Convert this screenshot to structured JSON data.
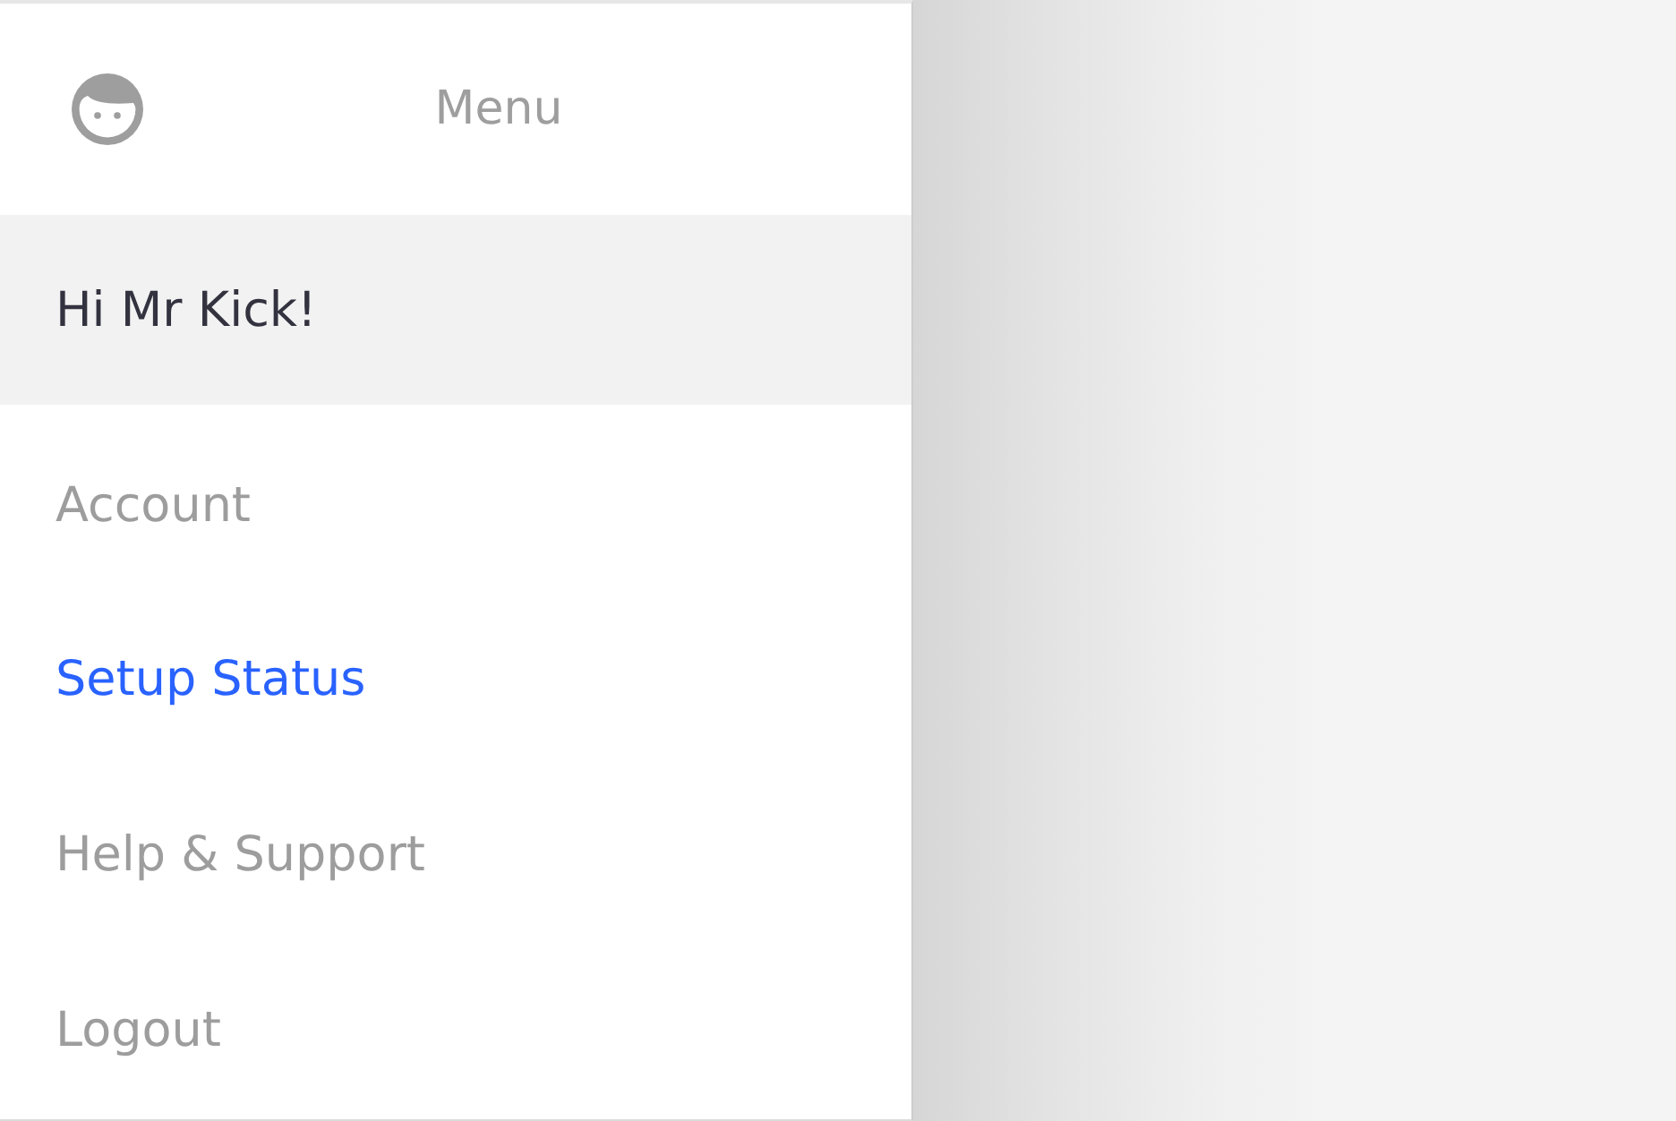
{
  "header": {
    "title": "Menu"
  },
  "greeting": "Hi Mr Kick!",
  "menu_items": [
    {
      "label": "Account",
      "selected": false
    },
    {
      "label": "Setup Status",
      "selected": true
    },
    {
      "label": "Help & Support",
      "selected": false
    },
    {
      "label": "Logout",
      "selected": false
    }
  ]
}
